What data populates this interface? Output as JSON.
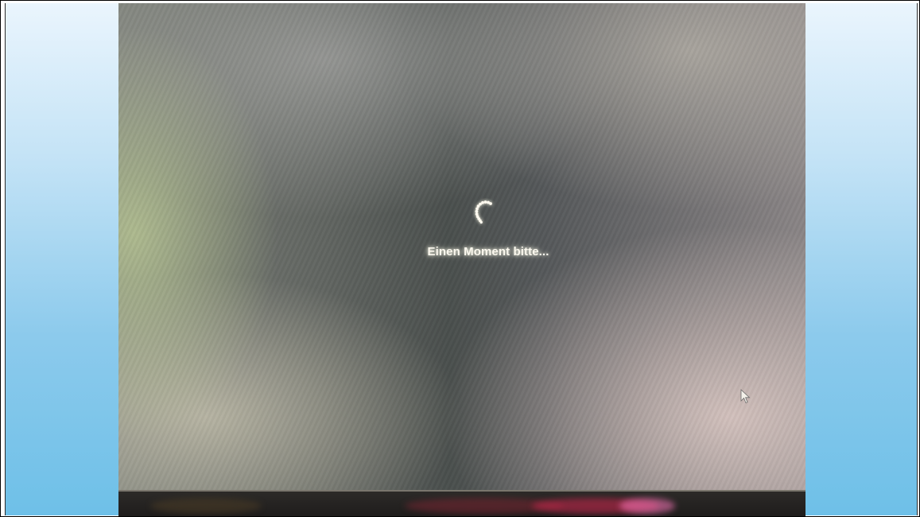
{
  "screen": {
    "loading_message": "Einen Moment bitte...",
    "spinner_icon": "loading-spinner-icon",
    "cursor_icon": "mouse-pointer-icon"
  },
  "colors": {
    "text": "#fbf8ee",
    "side_panel_top": "#eaf5fd",
    "side_panel_bottom": "#6ec0e8"
  }
}
